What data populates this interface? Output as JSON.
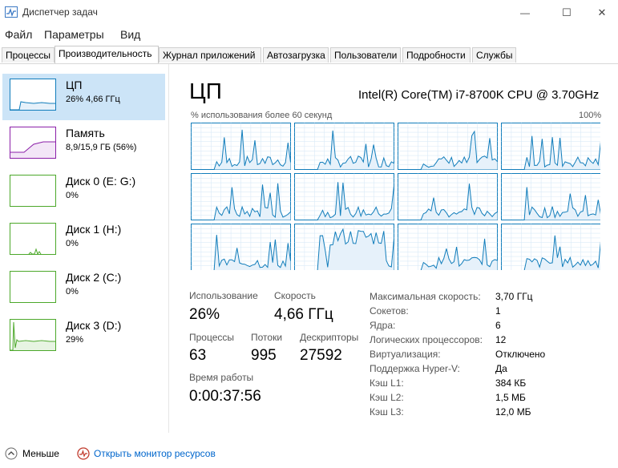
{
  "window": {
    "title": "Диспетчер задач",
    "minimize_glyph": "—",
    "maximize_glyph": "☐",
    "close_glyph": "✕"
  },
  "menu": [
    "Файл",
    "Параметры",
    "Вид"
  ],
  "tabs": [
    {
      "label": "Процессы",
      "active": false
    },
    {
      "label": "Производительность",
      "active": true
    },
    {
      "label": "Журнал приложений",
      "active": false
    },
    {
      "label": "Автозагрузка",
      "active": false
    },
    {
      "label": "Пользователи",
      "active": false
    },
    {
      "label": "Подробности",
      "active": false
    },
    {
      "label": "Службы",
      "active": false
    }
  ],
  "sidebar": [
    {
      "title": "ЦП",
      "subtitle": "26% 4,66 ГГц",
      "color": "#1f77b4",
      "active": true
    },
    {
      "title": "Память",
      "subtitle": "8,9/15,9 ГБ (56%)",
      "color": "#8b1fa8",
      "active": false
    },
    {
      "title": "Диск 0 (E: G:)",
      "subtitle": "0%",
      "color": "#4ca82a",
      "active": false
    },
    {
      "title": "Диск 1 (H:)",
      "subtitle": "0%",
      "color": "#4ca82a",
      "active": false
    },
    {
      "title": "Диск 2 (C:)",
      "subtitle": "0%",
      "color": "#4ca82a",
      "active": false
    },
    {
      "title": "Диск 3 (D:)",
      "subtitle": "29%",
      "color": "#4ca82a",
      "active": false
    }
  ],
  "main": {
    "title": "ЦП",
    "cpu_name": "Intel(R) Core(TM) i7-8700K CPU @ 3.70GHz",
    "util_label": "% использования более 60 секунд",
    "max_label": "100%",
    "graph_color": "#117dbb",
    "cores": 12
  },
  "stats": {
    "usage_label": "Использование",
    "usage_value": "26%",
    "speed_label": "Скорость",
    "speed_value": "4,66 ГГц",
    "processes_label": "Процессы",
    "processes_value": "63",
    "threads_label": "Потоки",
    "threads_value": "995",
    "handles_label": "Дескрипторы",
    "handles_value": "27592",
    "uptime_label": "Время работы",
    "uptime_value": "0:00:37:56"
  },
  "specs": [
    {
      "label": "Максимальная скорость:",
      "value": "3,70 ГГц"
    },
    {
      "label": "Сокетов:",
      "value": "1"
    },
    {
      "label": "Ядра:",
      "value": "6"
    },
    {
      "label": "Логических процессоров:",
      "value": "12"
    },
    {
      "label": "Виртуализация:",
      "value": "Отключено"
    },
    {
      "label": "Поддержка Hyper-V:",
      "value": "Да"
    },
    {
      "label": "Кэш L1:",
      "value": "384 КБ"
    },
    {
      "label": "Кэш L2:",
      "value": "1,5 МБ"
    },
    {
      "label": "Кэш L3:",
      "value": "12,0 МБ"
    }
  ],
  "footer": {
    "fewer_label": "Меньше",
    "monitor_link": "Открыть монитор ресурсов",
    "link_color": "#0066cc"
  }
}
